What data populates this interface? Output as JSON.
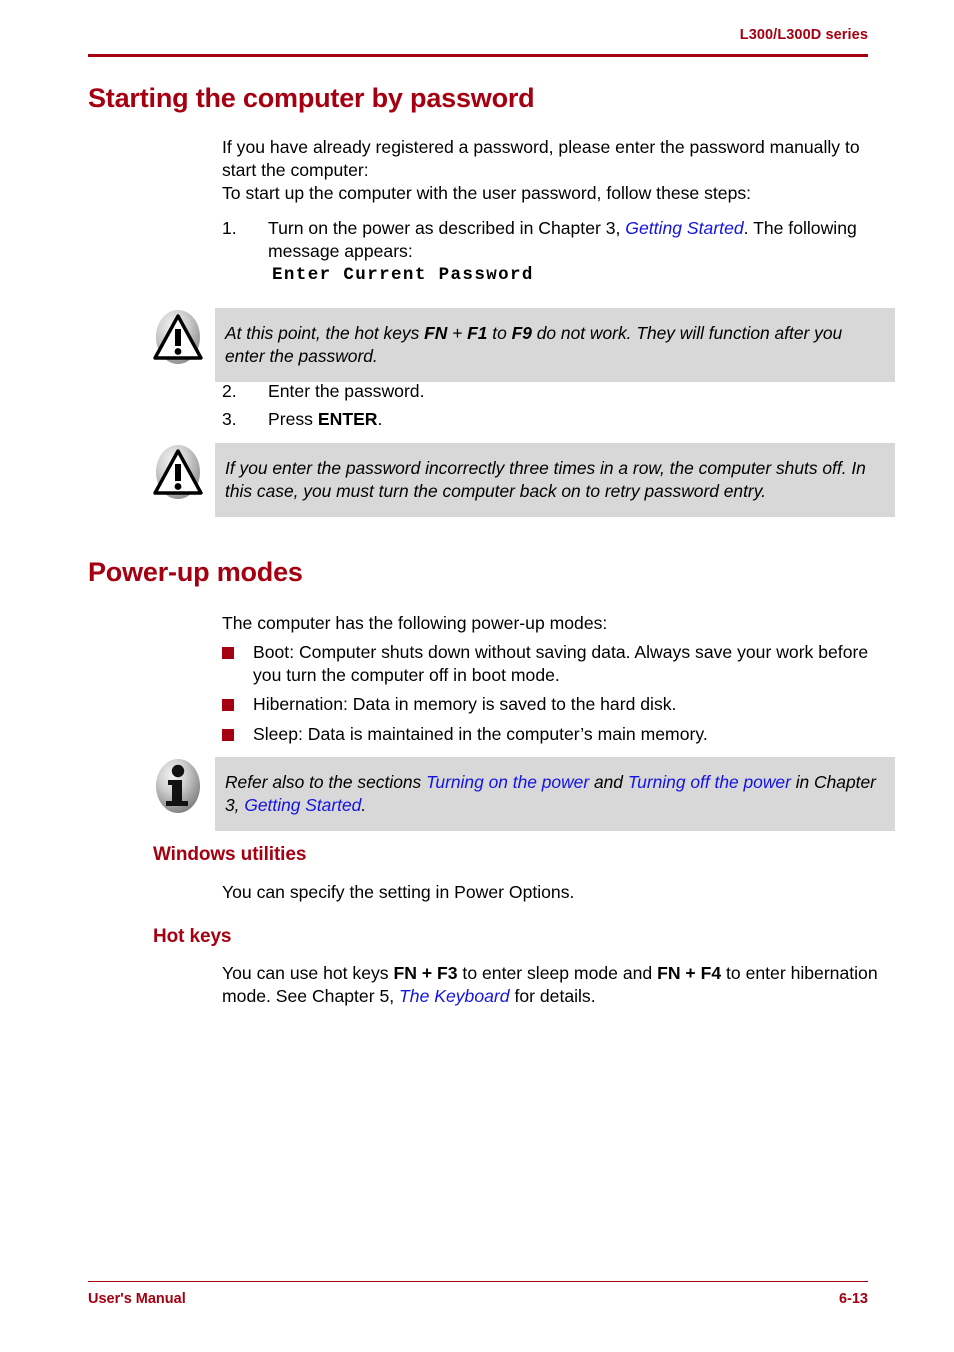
{
  "header": {
    "title": "L300/L300D series",
    "rule_color": "#A50011"
  },
  "footer": {
    "left_label": "User's Manual",
    "page_number": "6-13",
    "rule_color": "#A50011"
  },
  "colors": {
    "heading_red": "#A50011",
    "link_blue": "#1414E0",
    "note_gray": "#D8D8D8",
    "bullet_red": "#A50011"
  },
  "sections": {
    "password": {
      "heading": "Starting the computer by password",
      "intro_1": "If you have already registered a password, please enter the password manually to start the computer:",
      "intro_2": "To start up the computer with the user password, follow these steps:",
      "steps": [
        {
          "number": "1.",
          "text_before_link": "Turn on the power as described in Chapter 3, ",
          "link": "Getting Started",
          "text_after_link": ". The following message appears:"
        },
        {
          "number": "2.",
          "text_before_link": "Enter the password.",
          "link": "",
          "text_after_link": ""
        },
        {
          "number": "3.",
          "text_before_link": "Press ",
          "bold": "ENTER",
          "text_after_link": "."
        }
      ],
      "console_message": "Enter Current Password",
      "caution_1": {
        "icon": "caution-triangle-icon",
        "segments": [
          {
            "t": "At this point, the hot keys ",
            "style": "italic"
          },
          {
            "t": "FN",
            "style": "bold-italic"
          },
          {
            "t": " + ",
            "style": "italic"
          },
          {
            "t": "F1",
            "style": "bold-italic"
          },
          {
            "t": " to ",
            "style": "italic"
          },
          {
            "t": "F9",
            "style": "bold-italic"
          },
          {
            "t": " do not work. They will function after you enter the password.",
            "style": "italic"
          }
        ],
        "plain": "At this point, the hot keys FN + F1 to F9 do not work. They will function after you enter the password."
      },
      "caution_2": {
        "icon": "caution-triangle-icon",
        "plain": "If you enter the password incorrectly three times in a row, the computer shuts off. In this case, you must turn the computer back on to retry password entry."
      }
    },
    "powerup": {
      "heading": "Power-up modes",
      "intro": "The computer has the following power-up modes:",
      "bullets": [
        "Boot: Computer shuts down without saving data. Always save your work before you turn the computer off in boot mode.",
        "Hibernation: Data in memory is saved to the hard disk.",
        "Sleep: Data is maintained in the computer’s main memory."
      ],
      "info_note": {
        "icon": "info-circle-icon",
        "text_1": "Refer also to the sections ",
        "link_1": "Turning on the power",
        "text_2": " and ",
        "link_2": "Turning off the power",
        "text_3": " in Chapter 3, ",
        "link_3": "Getting Started",
        "text_4": "."
      },
      "windows_utilities": {
        "heading": "Windows utilities",
        "body": "You can specify the setting in Power Options."
      },
      "hot_keys": {
        "heading": "Hot keys",
        "text_1": "You can use hot keys ",
        "bold_1": "FN + F3",
        "text_2": " to enter sleep mode and ",
        "bold_2": "FN + F4",
        "text_3": " to enter hibernation mode. See Chapter 5, ",
        "link_1": "The Keyboard",
        "text_4": " for details."
      }
    }
  }
}
